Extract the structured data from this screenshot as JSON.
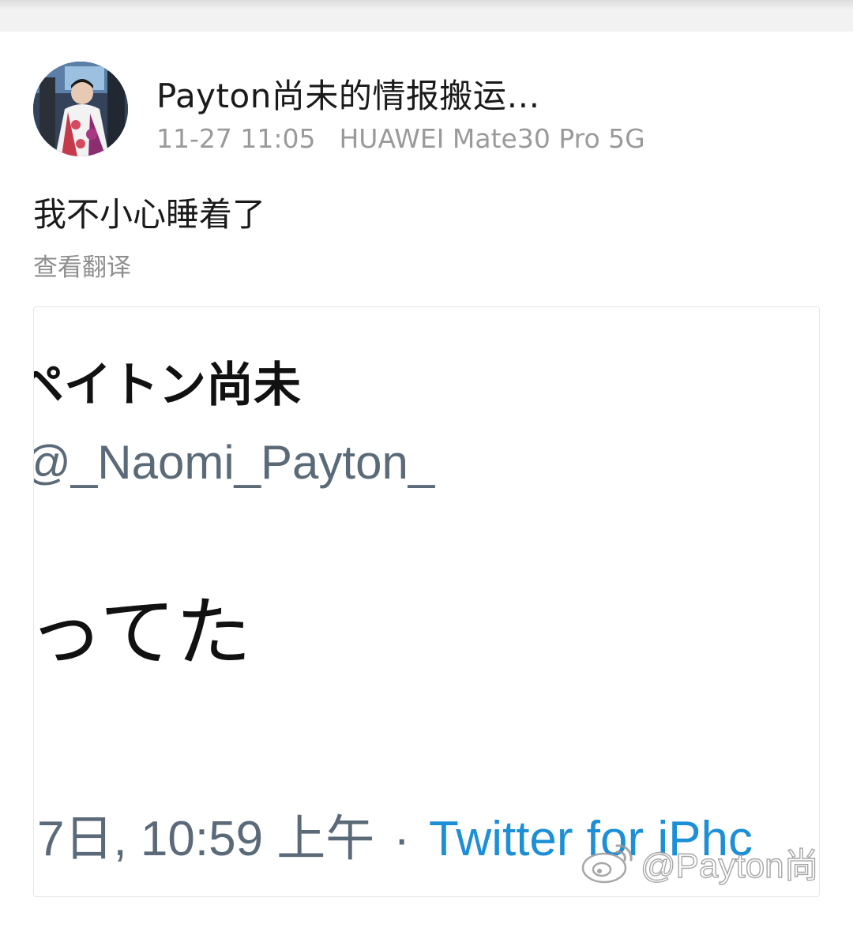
{
  "post": {
    "author": "Payton尚未的情报搬运…",
    "timestamp": "11-27 11:05",
    "device": "HUAWEI Mate30 Pro 5G",
    "text": "我不小心睡着了",
    "translate_label": "查看翻译"
  },
  "embedded_image": {
    "display_name": "ペイトン尚未",
    "handle": "@_Naomi_Payton_",
    "tweet_text": "ってた",
    "footer_time": "7日, 10:59 上午",
    "footer_separator": "·",
    "footer_source": "Twitter for iPhc",
    "watermark_text": "@Payton尚",
    "watermark_icon": "weibo-logo-icon"
  },
  "colors": {
    "top_strip": "#f2f2f2",
    "meta_text": "#9a9a9a",
    "twitter_blue": "#1d8fd6",
    "twitter_gray": "#5b6a78"
  }
}
